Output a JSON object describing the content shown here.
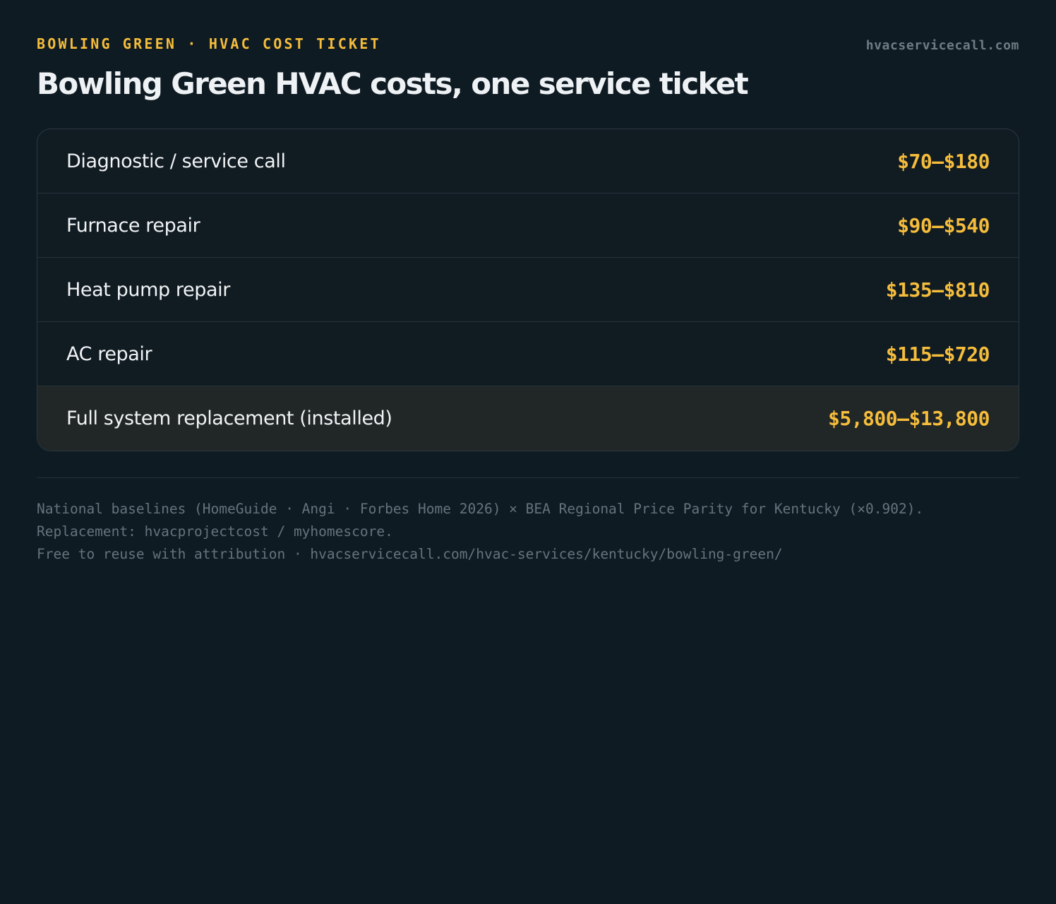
{
  "header": {
    "eyebrow": "BOWLING GREEN · HVAC COST TICKET",
    "site": "hvacservicecall.com",
    "title": "Bowling Green HVAC costs, one service ticket"
  },
  "ticket": {
    "rows": [
      {
        "label": "Diagnostic / service call",
        "price": "$70–$180"
      },
      {
        "label": "Furnace repair",
        "price": "$90–$540"
      },
      {
        "label": "Heat pump repair",
        "price": "$135–$810"
      },
      {
        "label": "AC repair",
        "price": "$115–$720"
      },
      {
        "label": "Full system replacement (installed)",
        "price": "$5,800–$13,800"
      }
    ]
  },
  "footer": {
    "line1": "National baselines (HomeGuide · Angi · Forbes Home 2026) × BEA Regional Price Parity for Kentucky (×0.902).",
    "line2": "Replacement: hvacprojectcost / myhomescore.",
    "line3": "Free to reuse with attribution · hvacservicecall.com/hvac-services/kentucky/bowling-green/"
  },
  "colors": {
    "background": "#0f1b23",
    "accent": "#f5bd3b",
    "text": "#eef2f5",
    "muted": "#66737c",
    "highlight_row": "#212626"
  }
}
